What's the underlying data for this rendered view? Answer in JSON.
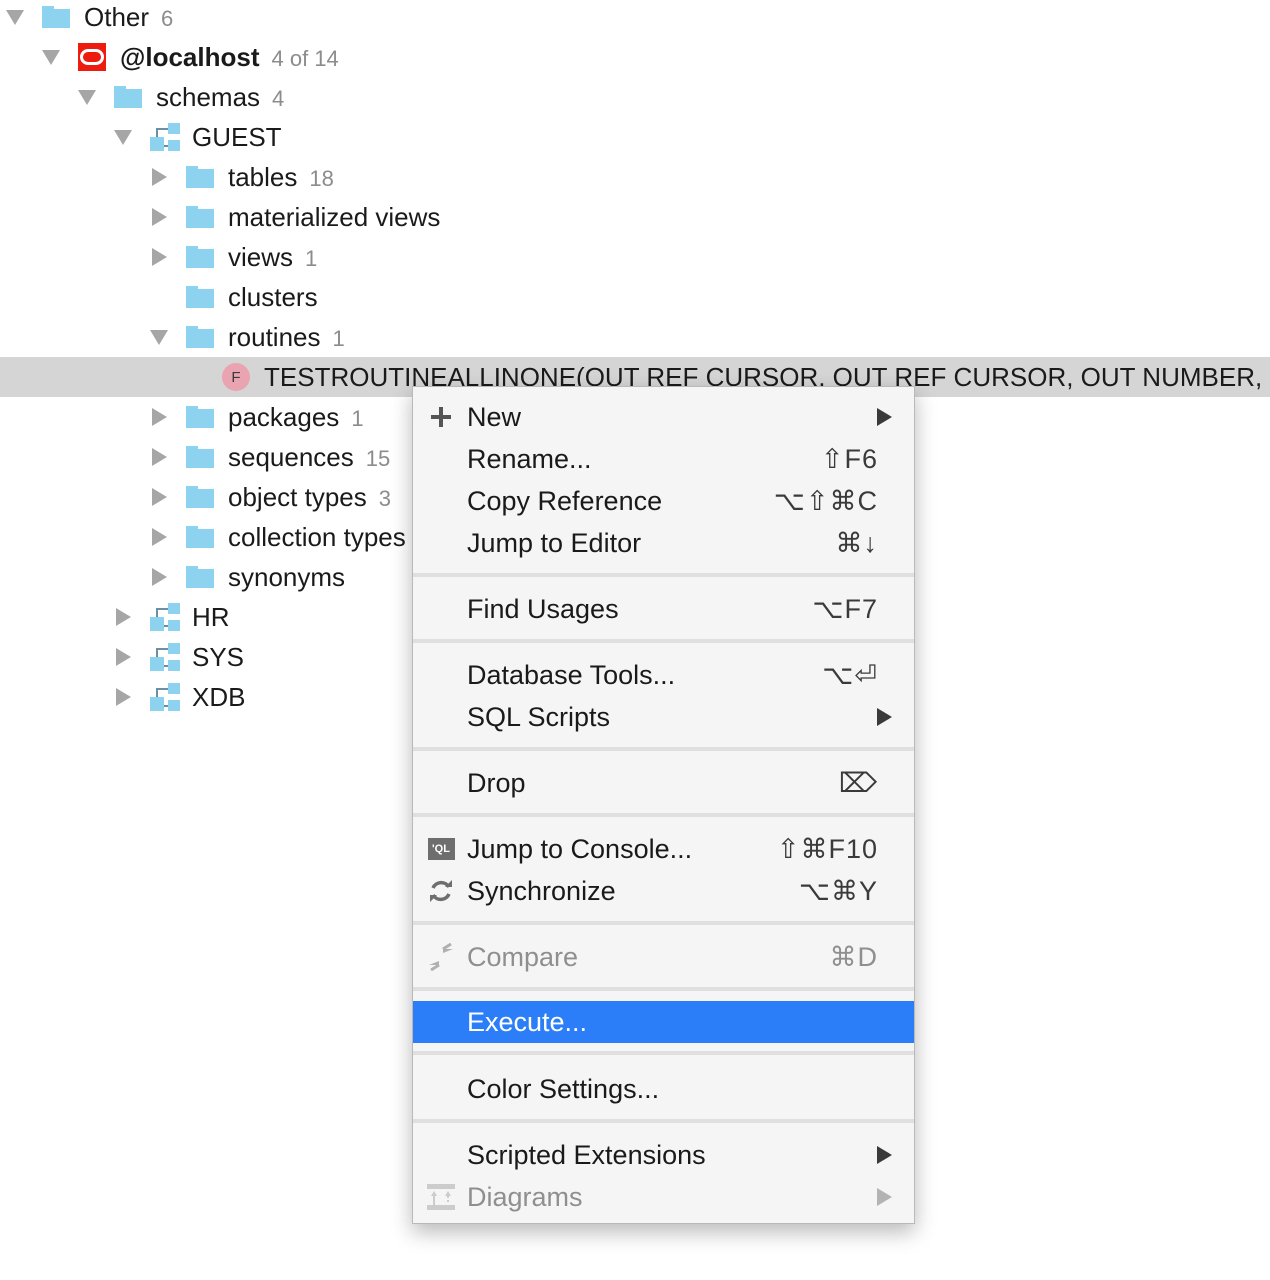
{
  "tree": {
    "other": {
      "label": "Other",
      "count": "6"
    },
    "connection": {
      "label": "@localhost",
      "count": "4 of 14"
    },
    "schemas": {
      "label": "schemas",
      "count": "4"
    },
    "guest": {
      "label": "GUEST"
    },
    "tables": {
      "label": "tables",
      "count": "18"
    },
    "materialized_views": {
      "label": "materialized views"
    },
    "views": {
      "label": "views",
      "count": "1"
    },
    "clusters": {
      "label": "clusters"
    },
    "routines": {
      "label": "routines",
      "count": "1"
    },
    "routine_item": {
      "icon_letter": "F",
      "label": "TESTROUTINEALLINONE(OUT REF CURSOR, OUT REF CURSOR, OUT NUMBER, OUT"
    },
    "packages": {
      "label": "packages",
      "count": "1"
    },
    "sequences": {
      "label": "sequences",
      "count": "15"
    },
    "object_types": {
      "label": "object types",
      "count": "3"
    },
    "collection_types": {
      "label": "collection types"
    },
    "synonyms": {
      "label": "synonyms"
    },
    "hr": {
      "label": "HR"
    },
    "sys": {
      "label": "SYS"
    },
    "xdb": {
      "label": "XDB"
    }
  },
  "context_menu": {
    "new": {
      "label": "New",
      "icon": "plus-icon"
    },
    "rename": {
      "label": "Rename...",
      "shortcut": "⇧F6"
    },
    "copy_reference": {
      "label": "Copy Reference",
      "shortcut": "⌥⇧⌘C"
    },
    "jump_to_editor": {
      "label": "Jump to Editor",
      "shortcut": "⌘↓"
    },
    "find_usages": {
      "label": "Find Usages",
      "shortcut": "⌥F7"
    },
    "database_tools": {
      "label": "Database Tools...",
      "shortcut": "⌥⏎"
    },
    "sql_scripts": {
      "label": "SQL Scripts"
    },
    "drop": {
      "label": "Drop",
      "shortcut": "⌦"
    },
    "jump_to_console": {
      "label": "Jump to Console...",
      "shortcut": "⇧⌘F10",
      "icon_text": "'QL"
    },
    "synchronize": {
      "label": "Synchronize",
      "shortcut": "⌥⌘Y"
    },
    "compare": {
      "label": "Compare",
      "shortcut": "⌘D"
    },
    "execute": {
      "label": "Execute..."
    },
    "color_settings": {
      "label": "Color Settings..."
    },
    "scripted_extensions": {
      "label": "Scripted Extensions"
    },
    "diagrams": {
      "label": "Diagrams"
    }
  },
  "colors": {
    "selection_highlight": "#2c7ef8",
    "tree_selection": "#d5d5d5",
    "folder": "#8dd3ef",
    "oracle_red": "#ec1c0f",
    "function_badge": "#eaa3b1"
  }
}
